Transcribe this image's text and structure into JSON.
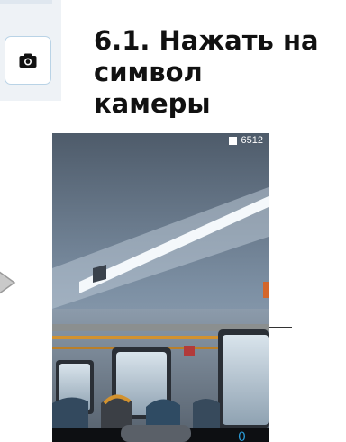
{
  "instruction": {
    "line1": "6.1. Нажать на",
    "line2": "символ",
    "line3": "камеры"
  },
  "camera_button": {
    "icon": "camera-icon"
  },
  "phone": {
    "status_counter": "6512",
    "status_icon": "sd-card-icon",
    "scene": "train-interior-camera-preview"
  },
  "colors": {
    "button_border": "#b9d3e6",
    "panel_bg": "#eef2f6",
    "marker": "#2a9bd6",
    "handrail": "#d2922f"
  },
  "marker_text": "0"
}
